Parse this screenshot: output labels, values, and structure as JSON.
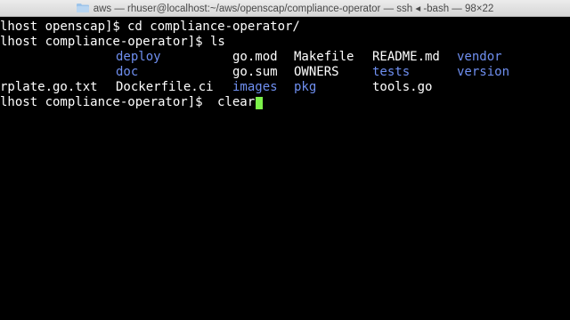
{
  "window": {
    "title": "aws — rhuser@localhost:~/aws/openscap/compliance-operator — ssh ◂ -bash — 98×22"
  },
  "terminal": {
    "line1": {
      "prompt": "lhost openscap]$ ",
      "command": "cd compliance-operator/"
    },
    "line2": {
      "prompt": "lhost compliance-operator]$ ",
      "command": "ls"
    },
    "ls_rows": [
      [
        "",
        "deploy",
        "go.mod",
        "Makefile",
        "README.md",
        "vendor"
      ],
      [
        "",
        "doc",
        "go.sum",
        "OWNERS",
        "tests",
        "version"
      ],
      [
        "rplate.go.txt",
        "Dockerfile.ci",
        "images",
        "pkg",
        "tools.go",
        ""
      ]
    ],
    "line6": {
      "prompt": "lhost compliance-operator]$ ",
      "command": "clear"
    },
    "colors": {
      "directory": "#6f8ff0",
      "file": "#ffffff",
      "cursor": "#7cf24a"
    }
  }
}
